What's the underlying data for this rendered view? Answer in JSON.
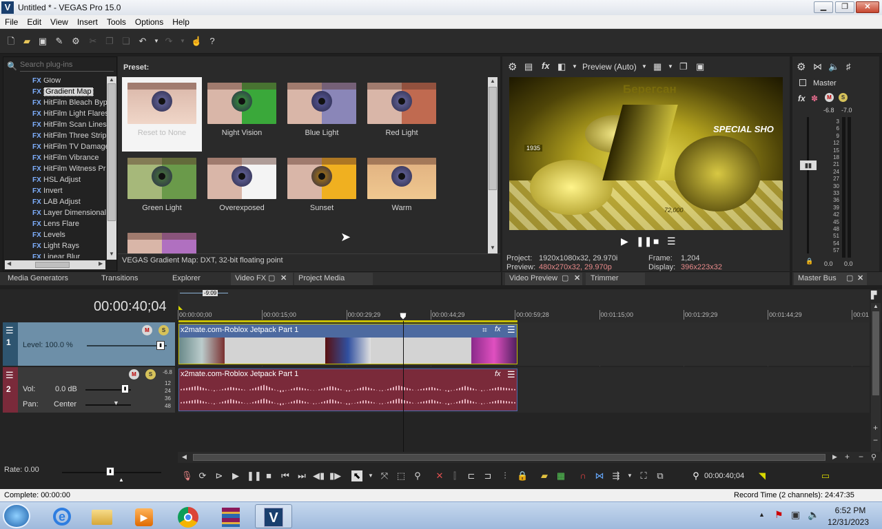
{
  "window": {
    "title": "Untitled * - VEGAS Pro 15.0",
    "logo": "V",
    "minimize": "▁",
    "restore": "❐",
    "close": "✕"
  },
  "menu": [
    "File",
    "Edit",
    "View",
    "Insert",
    "Tools",
    "Options",
    "Help"
  ],
  "plugins": {
    "search_placeholder": "Search plug-ins",
    "items": [
      "Glow",
      "Gradient Map",
      "HitFilm Bleach Byp",
      "HitFilm Light Flares",
      "HitFilm Scan Lines",
      "HitFilm Three Strip",
      "HitFilm TV Damage",
      "HitFilm Vibrance",
      "HitFilm Witness Pr",
      "HSL Adjust",
      "Invert",
      "LAB Adjust",
      "Layer Dimensional",
      "Lens Flare",
      "Levels",
      "Light Rays",
      "Linear Blur"
    ],
    "selected": "Gradient Map",
    "fx_tag": "FX"
  },
  "presets": {
    "label": "Preset:",
    "items": [
      "Reset to None",
      "Night Vision",
      "Blue Light",
      "Red Light",
      "Green Light",
      "Overexposed",
      "Sunset",
      "Warm"
    ],
    "status": "VEGAS Gradient Map: DXT, 32-bit floating point"
  },
  "tabs_left": [
    "Media Generators",
    "Transitions",
    "Explorer",
    "Video FX",
    "Project Media"
  ],
  "preview": {
    "mode": "Preview (Auto)",
    "project_label": "Project:",
    "project_value": "1920x1080x32, 29.970i",
    "preview_label": "Preview:",
    "preview_value": "480x270x32, 29.970p",
    "frame_label": "Frame:",
    "frame_value": "1,204",
    "display_label": "Display:",
    "display_value": "396x223x32",
    "overlay_top": "Берегсан",
    "overlay_special": "SPECIAL SHO",
    "overlay_num": "1935",
    "overlay_bottom": "72,000"
  },
  "tabs_preview": [
    "Video Preview",
    "Trimmer"
  ],
  "master": {
    "label": "Master",
    "peak_l": "-6.8",
    "peak_r": "-7.0",
    "scale": [
      "3",
      "6",
      "9",
      "12",
      "15",
      "18",
      "21",
      "24",
      "27",
      "30",
      "33",
      "36",
      "39",
      "42",
      "45",
      "48",
      "51",
      "54",
      "57"
    ],
    "bottom_l": "0.0",
    "bottom_r": "0.0",
    "tab": "Master Bus"
  },
  "timeline": {
    "timecode": "00:00:40;04",
    "loop_marker": "-9:09",
    "ruler": [
      "00:00:00;00",
      "00:00:15;00",
      "00:00:29;29",
      "00:00:44;29",
      "00:00:59;28",
      "00:01:15;00",
      "00:01:29;29",
      "00:01:44;29",
      "00:01"
    ],
    "video_track": {
      "num": "1",
      "level_label": "Level: 100.0 %",
      "clip": "x2mate.com-Roblox Jetpack Part 1"
    },
    "audio_track": {
      "num": "2",
      "vol_label": "Vol:",
      "vol_value": "0.0 dB",
      "pan_label": "Pan:",
      "pan_value": "Center",
      "meter_top": "-6.8",
      "meter_marks": [
        "12",
        "24",
        "36",
        "48"
      ],
      "clip": "x2mate.com-Roblox Jetpack Part 1"
    },
    "rate": "Rate: 0.00",
    "transport_time": "00:00:40;04"
  },
  "status": {
    "left": "Complete: 00:00:00",
    "right": "Record Time (2 channels): 24:47:35"
  },
  "taskbar": {
    "time": "6:52 PM",
    "date": "12/31/2023"
  }
}
